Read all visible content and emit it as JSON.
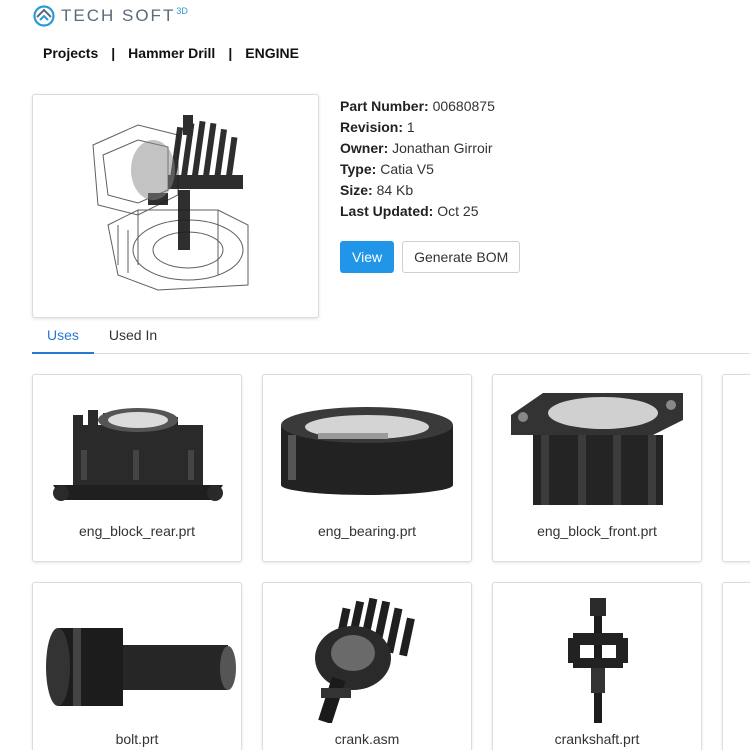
{
  "brand": {
    "name": "TECH SOFT",
    "suffix": "3D"
  },
  "breadcrumb": [
    "Projects",
    "Hammer Drill",
    "ENGINE"
  ],
  "breadcrumb_separator": "|",
  "details": {
    "part_number_label": "Part Number:",
    "part_number": "00680875",
    "revision_label": "Revision:",
    "revision": "1",
    "owner_label": "Owner:",
    "owner": "Jonathan Girroir",
    "type_label": "Type:",
    "type": "Catia V5",
    "size_label": "Size:",
    "size": "84 Kb",
    "updated_label": "Last Updated:",
    "updated": "Oct 25"
  },
  "actions": {
    "view": "View",
    "generate_bom": "Generate BOM"
  },
  "tabs": [
    {
      "label": "Uses",
      "active": true
    },
    {
      "label": "Used In",
      "active": false
    }
  ],
  "parts": [
    {
      "name": "eng_block_rear.prt"
    },
    {
      "name": "eng_bearing.prt"
    },
    {
      "name": "eng_block_front.prt"
    },
    {
      "name": "bolt.prt"
    },
    {
      "name": "crank.asm"
    },
    {
      "name": "crankshaft.prt"
    }
  ],
  "colors": {
    "accent": "#2196e8",
    "tab_active": "#2878d0",
    "logo_blue": "#2a9ad6"
  }
}
